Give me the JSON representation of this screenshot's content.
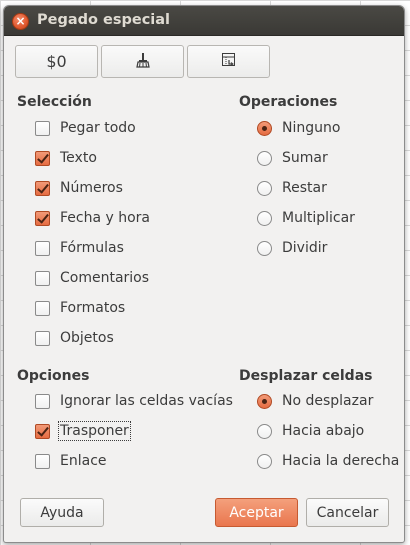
{
  "window": {
    "title": "Pegado especial",
    "close_glyph": "×"
  },
  "toolbar": {
    "btn1_label": "$0",
    "btn2_icon": "paintbrush-icon",
    "btn3_icon": "paste-special-icon"
  },
  "seleccion": {
    "title": "Selección",
    "items": [
      {
        "label": "Pegar todo",
        "checked": false
      },
      {
        "label": "Texto",
        "checked": true
      },
      {
        "label": "Números",
        "checked": true
      },
      {
        "label": "Fecha y hora",
        "checked": true
      },
      {
        "label": "Fórmulas",
        "checked": false
      },
      {
        "label": "Comentarios",
        "checked": false
      },
      {
        "label": "Formatos",
        "checked": false
      },
      {
        "label": "Objetos",
        "checked": false
      }
    ]
  },
  "operaciones": {
    "title": "Operaciones",
    "items": [
      {
        "label": "Ninguno",
        "selected": true
      },
      {
        "label": "Sumar",
        "selected": false
      },
      {
        "label": "Restar",
        "selected": false
      },
      {
        "label": "Multiplicar",
        "selected": false
      },
      {
        "label": "Dividir",
        "selected": false
      }
    ]
  },
  "opciones": {
    "title": "Opciones",
    "items": [
      {
        "label": "Ignorar las celdas vacías",
        "checked": false
      },
      {
        "label": "Trasponer",
        "checked": true
      },
      {
        "label": "Enlace",
        "checked": false
      }
    ]
  },
  "desplazar": {
    "title": "Desplazar celdas",
    "items": [
      {
        "label": "No desplazar",
        "selected": true
      },
      {
        "label": "Hacia abajo",
        "selected": false
      },
      {
        "label": "Hacia la derecha",
        "selected": false
      }
    ]
  },
  "buttons": {
    "help": "Ayuda",
    "ok": "Aceptar",
    "cancel": "Cancelar"
  },
  "colors": {
    "accent": "#e9764e",
    "titlebar": "#3f3e3a",
    "dialog_bg": "#f2f1f0"
  }
}
